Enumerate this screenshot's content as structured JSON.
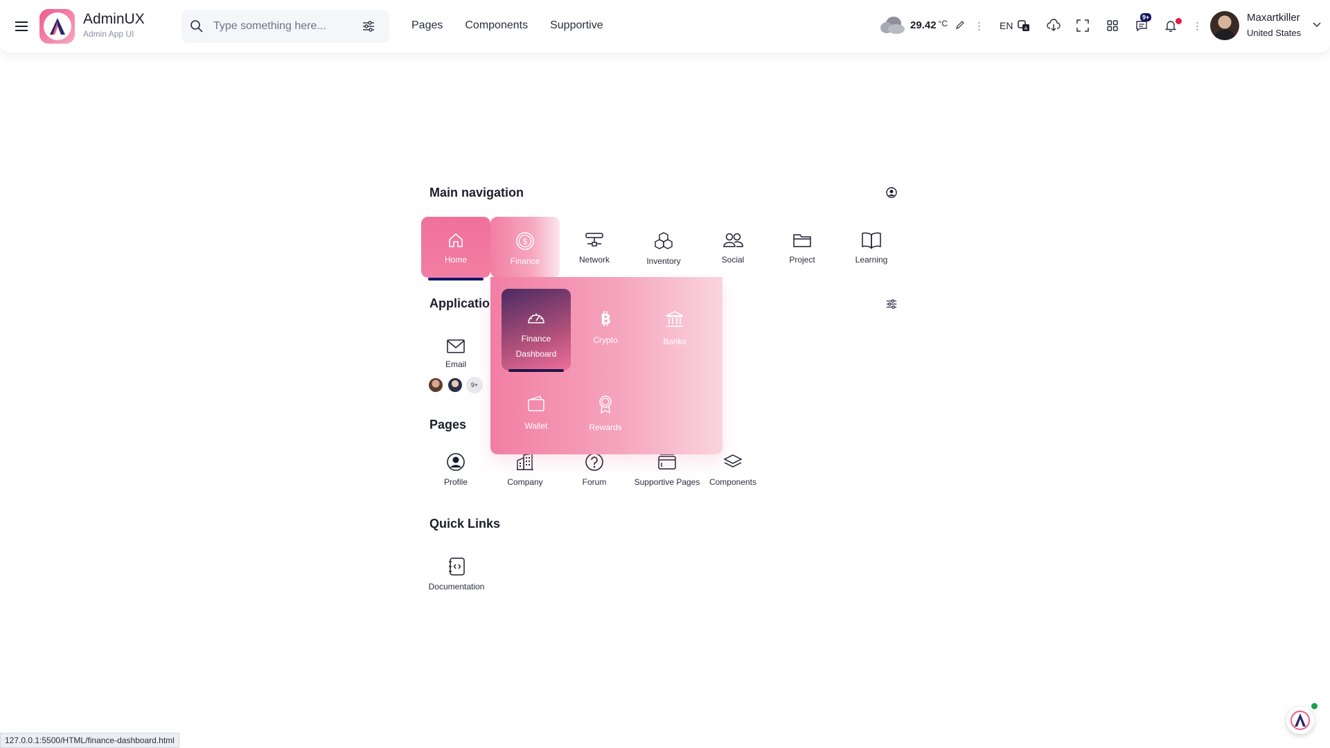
{
  "brand": {
    "title": "AdminUX",
    "subtitle": "Admin App UI"
  },
  "search": {
    "placeholder": "Type something here..."
  },
  "top_nav": [
    "Pages",
    "Components",
    "Supportive"
  ],
  "weather": {
    "temperature": "29.42",
    "unit": "°C",
    "icon": "cloud-icon"
  },
  "language": "EN",
  "messages_badge": "9+",
  "user": {
    "name": "Maxartkiller",
    "country": "United States"
  },
  "main_navigation": {
    "title": "Main navigation",
    "items": [
      {
        "label": "Home",
        "icon": "home-icon"
      },
      {
        "label": "Finance",
        "icon": "dollar-coin-icon"
      },
      {
        "label": "Network",
        "icon": "network-icon"
      },
      {
        "label": "Inventory",
        "icon": "boxes-icon"
      },
      {
        "label": "Social",
        "icon": "people-icon"
      },
      {
        "label": "Project",
        "icon": "folder-icon"
      },
      {
        "label": "Learning",
        "icon": "book-icon"
      }
    ]
  },
  "finance_menu": {
    "items": [
      {
        "label": "Finance Dashboard",
        "icon": "speedometer-icon"
      },
      {
        "label": "Crypto",
        "icon": "bitcoin-icon"
      },
      {
        "label": "Banks",
        "icon": "bank-icon"
      },
      {
        "label": "Wallet",
        "icon": "wallet-icon"
      },
      {
        "label": "Rewards",
        "icon": "award-icon"
      }
    ]
  },
  "applications": {
    "title": "Applications",
    "items": [
      {
        "label": "Email",
        "icon": "envelope-icon",
        "more": "9+"
      }
    ]
  },
  "pages": {
    "title": "Pages",
    "items": [
      {
        "label": "Profile",
        "icon": "person-circle-icon"
      },
      {
        "label": "Company",
        "icon": "building-icon"
      },
      {
        "label": "Forum",
        "icon": "question-circle-icon"
      },
      {
        "label": "Supportive Pages",
        "icon": "window-stack-icon"
      },
      {
        "label": "Components",
        "icon": "layers-icon"
      }
    ]
  },
  "quick_links": {
    "title": "Quick Links",
    "items": [
      {
        "label": "Documentation",
        "icon": "code-file-icon"
      }
    ]
  },
  "status_url": "127.0.0.1:5500/HTML/finance-dashboard.html",
  "colors": {
    "accent_pink": "#f0709c",
    "active_underline": "#15186b",
    "notification_dot": "#e8194a",
    "online_dot": "#14a44d"
  }
}
